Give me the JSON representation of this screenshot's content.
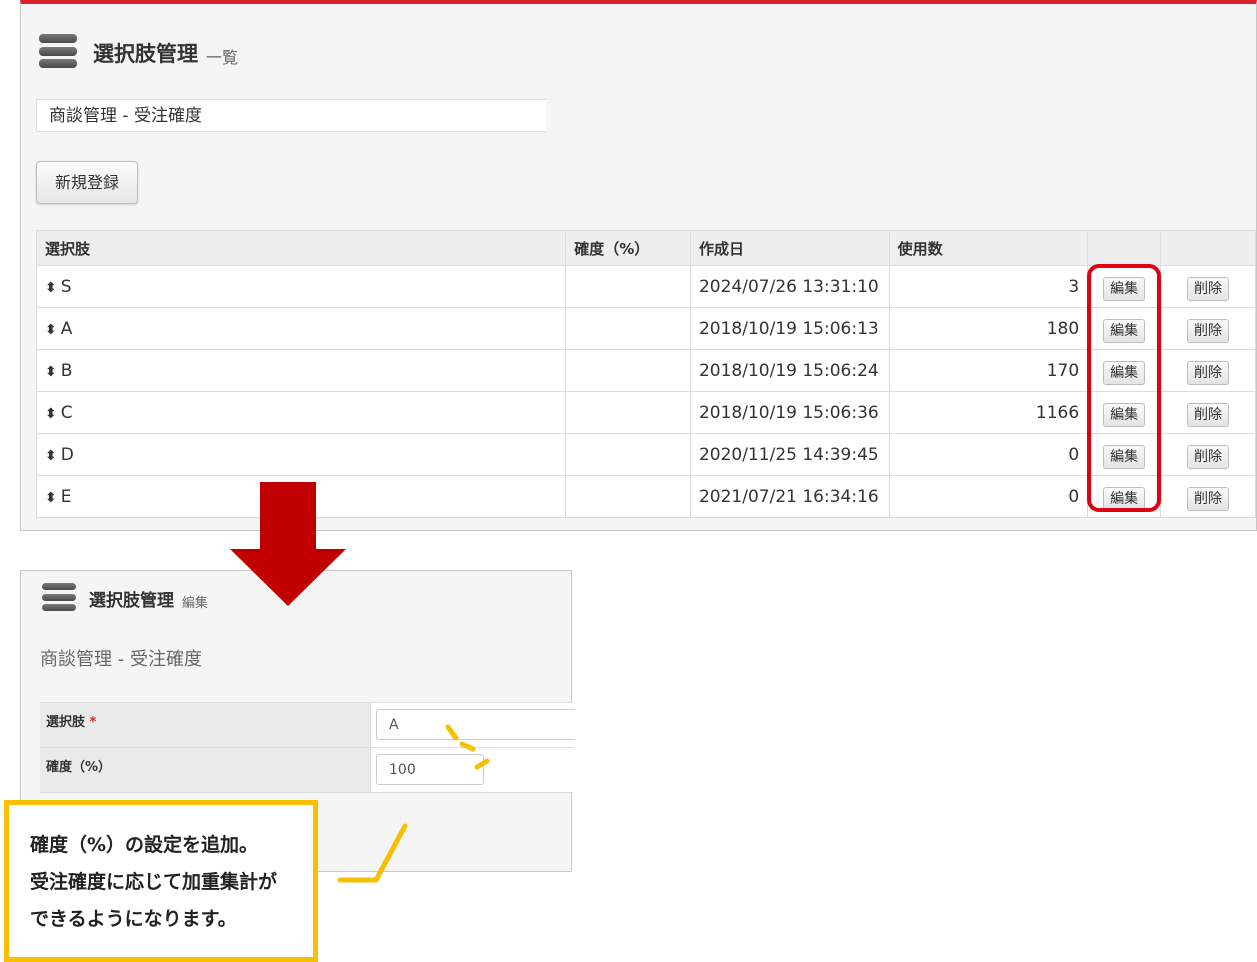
{
  "list_view": {
    "title": "選択肢管理",
    "subtitle": "一覧",
    "category": "商談管理 - 受注確度",
    "new_button": "新規登録",
    "columns": [
      "選択肢",
      "確度（%）",
      "作成日",
      "使用数",
      "",
      ""
    ],
    "rows": [
      {
        "choice": "S",
        "probability": "",
        "created": "2024/07/26 13:31:10",
        "usage": "3",
        "edit": "編集",
        "delete": "削除"
      },
      {
        "choice": "A",
        "probability": "",
        "created": "2018/10/19 15:06:13",
        "usage": "180",
        "edit": "編集",
        "delete": "削除"
      },
      {
        "choice": "B",
        "probability": "",
        "created": "2018/10/19 15:06:24",
        "usage": "170",
        "edit": "編集",
        "delete": "削除"
      },
      {
        "choice": "C",
        "probability": "",
        "created": "2018/10/19 15:06:36",
        "usage": "1166",
        "edit": "編集",
        "delete": "削除"
      },
      {
        "choice": "D",
        "probability": "",
        "created": "2020/11/25 14:39:45",
        "usage": "0",
        "edit": "編集",
        "delete": "削除"
      },
      {
        "choice": "E",
        "probability": "",
        "created": "2021/07/21 16:34:16",
        "usage": "0",
        "edit": "編集",
        "delete": "削除"
      }
    ],
    "sort_icon": "⬍"
  },
  "edit_view": {
    "title": "選択肢管理",
    "subtitle": "編集",
    "category": "商談管理 - 受注確度",
    "fields": [
      {
        "label": "選択肢",
        "required_mark": "*",
        "value": "A"
      },
      {
        "label": "確度（%）",
        "value": "100"
      }
    ]
  },
  "callout": {
    "lines": [
      "確度（%）の設定を追加。",
      "受注確度に応じて加重集計が",
      "できるようになります。"
    ]
  },
  "colors": {
    "accent_red": "#d9232b",
    "highlight_red": "#e00012",
    "arrow_red": "#c00000",
    "callout_yellow": "#fabe00"
  },
  "icons": [
    "database-icon",
    "sort-icon",
    "down-arrow-icon"
  ]
}
